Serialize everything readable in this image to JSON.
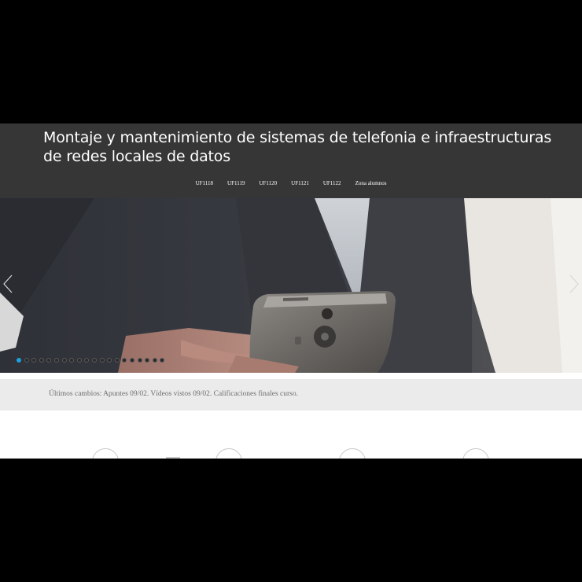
{
  "header": {
    "title": "Montaje y mantenimiento de sistemas de telefonia e infraestructuras de redes locales de datos"
  },
  "nav": {
    "items": [
      "UF1118",
      "UF1119",
      "UF1120",
      "UF1121",
      "UF1122",
      "Zona alumnos"
    ]
  },
  "slider": {
    "slide_count": 20,
    "active_index": 0,
    "active_dot_color": "#1e9fe0",
    "prev_icon": "chevron-left-icon",
    "next_icon": "chevron-right-icon"
  },
  "updates": {
    "text": "Últimos cambios: Apuntes 09/02. Vídeos vistos 09/02. Calificaciones finales curso."
  },
  "features": {
    "icons": [
      "circle-icon",
      "circle-icon",
      "circle-icon",
      "circle-icon"
    ]
  },
  "colors": {
    "header_bg": "#363636",
    "updates_bg": "#ebebeb",
    "letterbox": "#000000"
  }
}
